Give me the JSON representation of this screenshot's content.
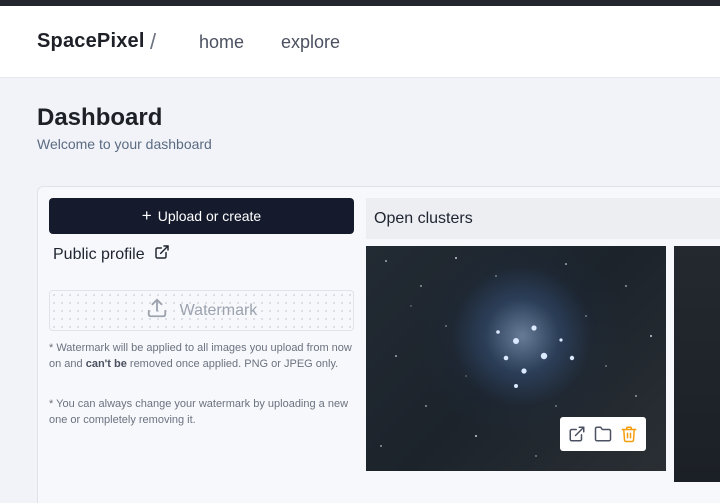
{
  "header": {
    "brand": "SpacePixel",
    "separator": "/",
    "nav": {
      "home": "home",
      "explore": "explore"
    }
  },
  "page": {
    "title": "Dashboard",
    "subtitle": "Welcome to your dashboard"
  },
  "sidebar": {
    "upload_button_label": "Upload or create",
    "public_profile_label": "Public profile",
    "watermark_label": "Watermark",
    "note1_part1": "* Watermark will be applied to all images you upload from now on and ",
    "note1_bold": "can't be",
    "note1_part2": " removed once applied. PNG or JPEG only.",
    "note2": "* You can always change your watermark by uploading a new one or completely removing it."
  },
  "album": {
    "title": "Open clusters"
  },
  "icons": {
    "plus": "plus-icon",
    "external_link": "external-link-icon",
    "upload": "upload-icon",
    "folder": "folder-icon",
    "trash": "trash-icon"
  },
  "colors": {
    "primary_button": "#151b2d",
    "delete_icon": "#f59e0b",
    "page_background": "#f1f3f8"
  }
}
